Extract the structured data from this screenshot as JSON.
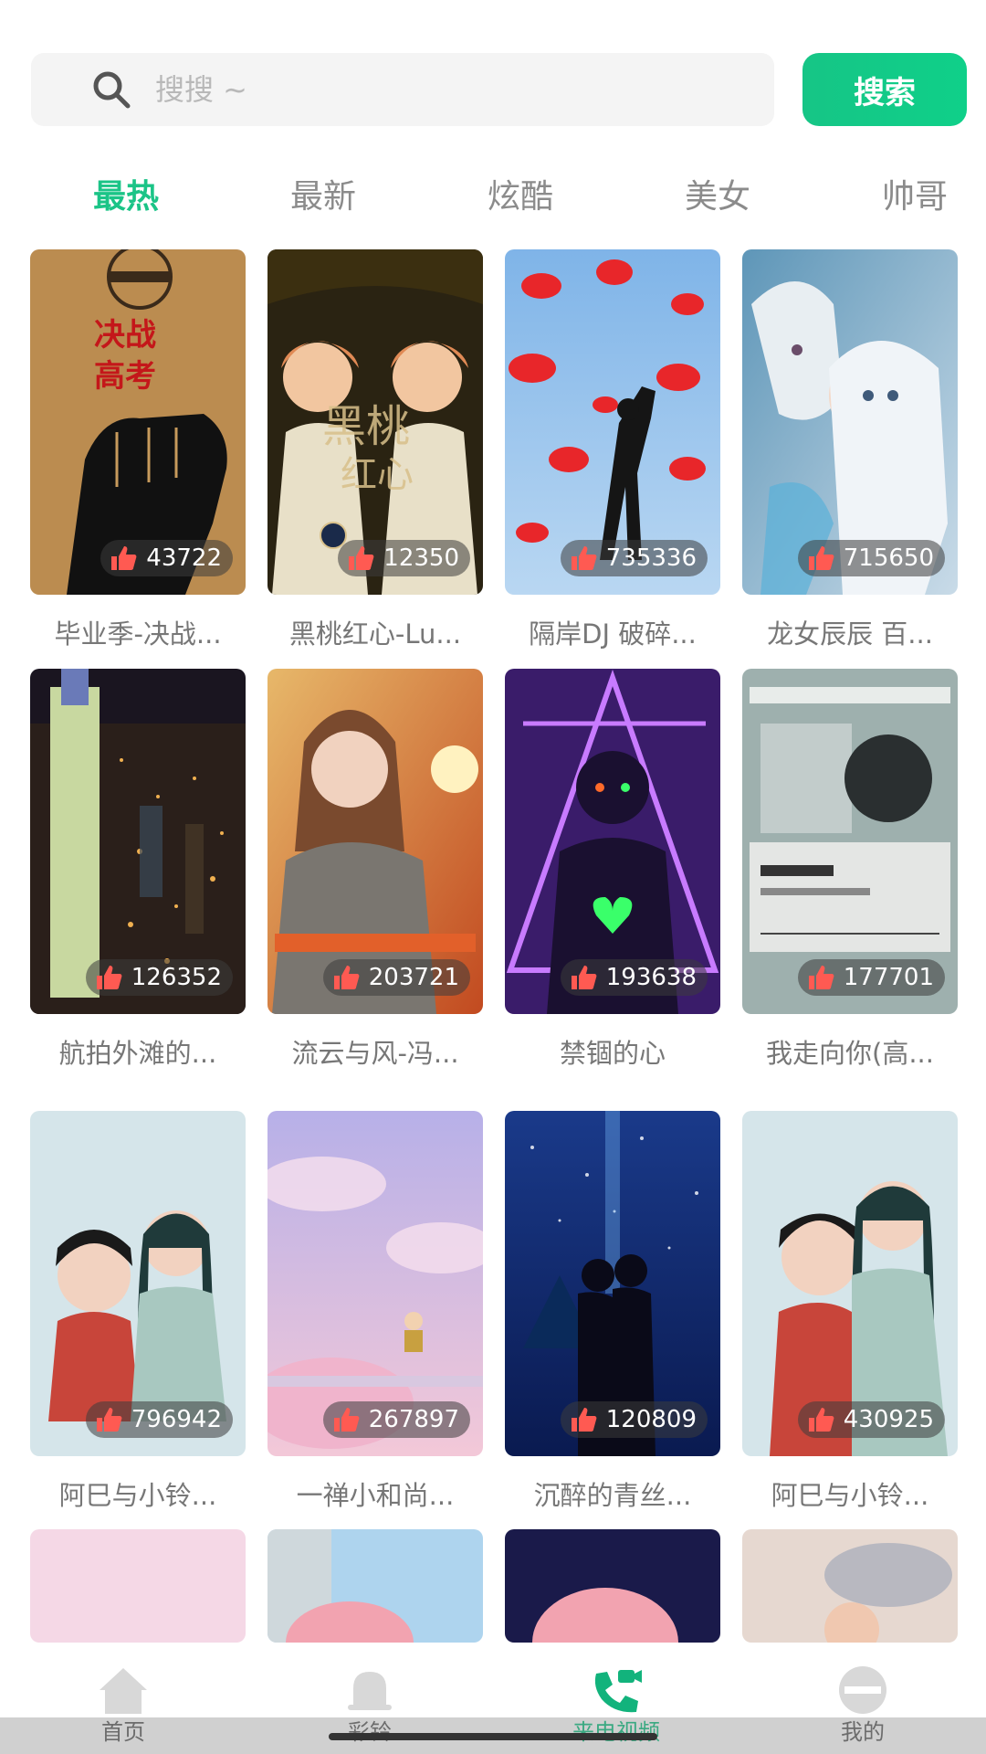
{
  "search": {
    "placeholder": "搜搜 ~",
    "button_label": "搜索"
  },
  "tabs": [
    {
      "label": "最热",
      "active": true
    },
    {
      "label": "最新",
      "active": false
    },
    {
      "label": "炫酷",
      "active": false
    },
    {
      "label": "美女",
      "active": false
    },
    {
      "label": "帅哥",
      "active": false
    }
  ],
  "videos": [
    {
      "likes": "43722",
      "caption": "毕业季-决战..."
    },
    {
      "likes": "12350",
      "caption": "黑桃红心-Lu..."
    },
    {
      "likes": "735336",
      "caption": "隔岸DJ 破碎..."
    },
    {
      "likes": "715650",
      "caption": "龙女辰辰 百..."
    },
    {
      "likes": "126352",
      "caption": "航拍外滩的..."
    },
    {
      "likes": "203721",
      "caption": "流云与风-冯..."
    },
    {
      "likes": "193638",
      "caption": "禁锢的心"
    },
    {
      "likes": "177701",
      "caption": "我走向你(高..."
    },
    {
      "likes": "796942",
      "caption": "阿巳与小铃..."
    },
    {
      "likes": "267897",
      "caption": "一禅小和尚..."
    },
    {
      "likes": "120809",
      "caption": "沉醉的青丝..."
    },
    {
      "likes": "430925",
      "caption": "阿巳与小铃..."
    }
  ],
  "bottom_nav": [
    {
      "label": "首页",
      "icon": "home-icon",
      "active": false
    },
    {
      "label": "彩铃",
      "icon": "bell-icon",
      "active": false
    },
    {
      "label": "来电视频",
      "icon": "video-call-icon",
      "active": true
    },
    {
      "label": "我的",
      "icon": "profile-icon",
      "active": false
    }
  ],
  "colors": {
    "accent": "#1bc487",
    "tab_inactive": "#8b8b8b"
  }
}
